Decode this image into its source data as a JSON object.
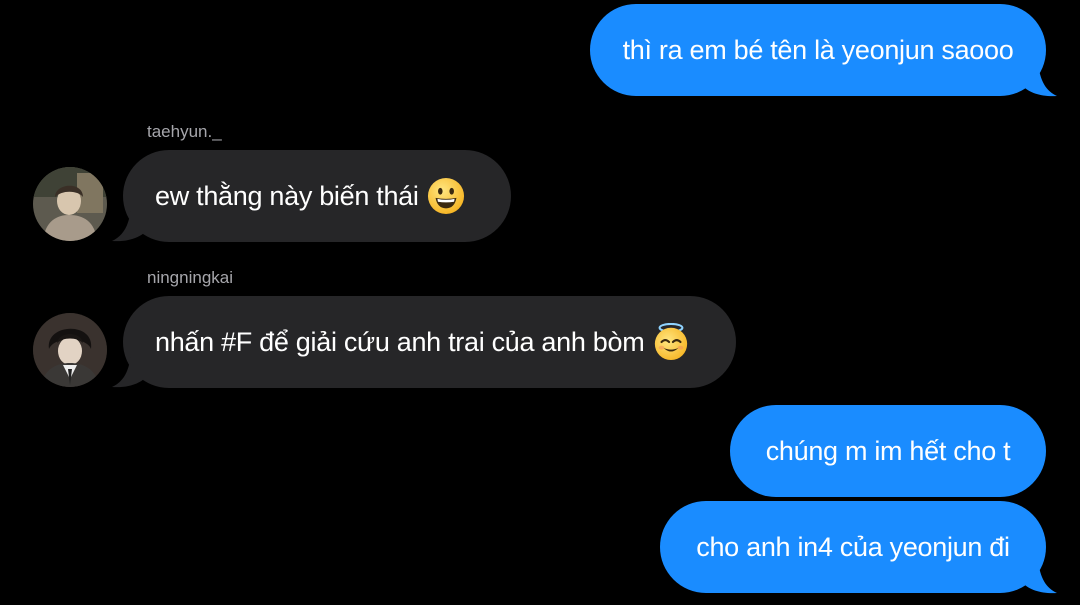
{
  "messages": [
    {
      "direction": "outgoing",
      "text": "thì ra em bé tên là yeonjun saooo"
    },
    {
      "direction": "incoming",
      "sender": "taehyun._",
      "text": "ew thằng này biến thái",
      "emoji": "grinning-face-icon"
    },
    {
      "direction": "incoming",
      "sender": "ningningkai",
      "text": "nhấn #F để giải cứu anh trai của anh bòm",
      "emoji": "smiling-face-with-halo-icon"
    },
    {
      "direction": "outgoing",
      "text": "chúng m im hết cho t"
    },
    {
      "direction": "outgoing",
      "text": "cho anh in4 của yeonjun đi"
    }
  ],
  "colors": {
    "background": "#000000",
    "outgoing_bubble": "#1a8cff",
    "incoming_bubble": "#262628",
    "sender_name": "#a6a6ab"
  }
}
